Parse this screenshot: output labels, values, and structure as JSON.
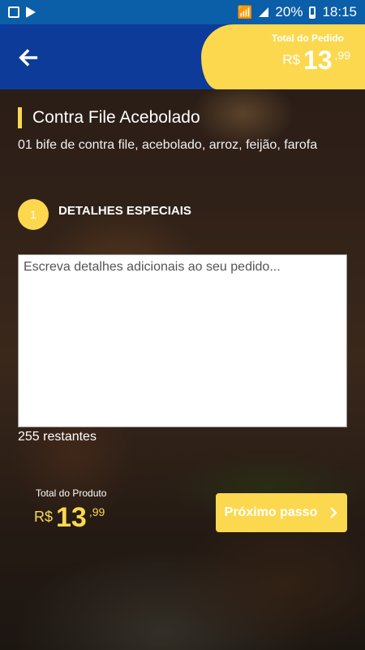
{
  "status_bar": {
    "battery": "20%",
    "time": "18:15"
  },
  "header": {
    "order_total_label": "Total do Pedido",
    "order_total": {
      "currency": "R$",
      "integer": "13",
      "cents": ",99"
    }
  },
  "product": {
    "title": "Contra File Acebolado",
    "description": "01 bife de contra file, acebolado, arroz, feijão, farofa"
  },
  "step": {
    "number": "1",
    "title": "DETALHES ESPECIAIS"
  },
  "details": {
    "placeholder": "Escreva detalhes adicionais ao seu pedido...",
    "remaining": "255 restantes"
  },
  "footer": {
    "product_total_label": "Total do Produto",
    "product_total": {
      "currency": "R$",
      "integer": "13",
      "cents": ",99"
    },
    "next_button_label": "Próximo passo"
  },
  "colors": {
    "accent": "#fcd84f",
    "header": "#0d3b9a",
    "status_bar": "#0b5ea8"
  }
}
